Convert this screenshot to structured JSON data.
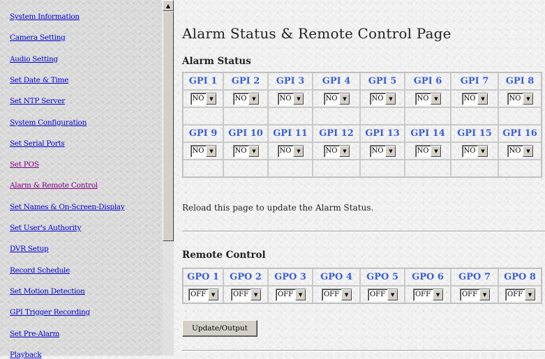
{
  "sidebar": {
    "items": [
      {
        "label": "System Information",
        "visited": false
      },
      {
        "label": "Camera Setting",
        "visited": false
      },
      {
        "label": "Audio Setting",
        "visited": false
      },
      {
        "label": "Set Date & Time",
        "visited": false
      },
      {
        "label": "Set NTP Server",
        "visited": false
      },
      {
        "label": "System Configuration",
        "visited": false
      },
      {
        "label": "Set Serial Ports",
        "visited": false
      },
      {
        "label": "Set POS",
        "visited": true
      },
      {
        "label": "Alarm & Remote Control",
        "visited": true
      },
      {
        "label": "Set Names & On-Screen-Display",
        "visited": false
      },
      {
        "label": "Set User's Authority",
        "visited": false
      },
      {
        "label": "DVR Setup",
        "visited": false
      },
      {
        "label": "Record Schedule",
        "visited": false
      },
      {
        "label": "Set Motion Detection",
        "visited": false
      },
      {
        "label": "GPI Trigger Recording",
        "visited": false
      },
      {
        "label": "Set Pre-Alarm",
        "visited": false
      },
      {
        "label": "Playback",
        "visited": false
      }
    ]
  },
  "page": {
    "title": "Alarm Status & Remote Control Page"
  },
  "alarm_status": {
    "heading": "Alarm Status",
    "rows": [
      {
        "headers": [
          "GPI 1",
          "GPI 2",
          "GPI 3",
          "GPI 4",
          "GPI 5",
          "GPI 6",
          "GPI 7",
          "GPI 8"
        ],
        "values": [
          "NO",
          "NO",
          "NO",
          "NO",
          "NO",
          "NO",
          "NO",
          "NO"
        ]
      },
      {
        "headers": [
          "GPI 9",
          "GPI 10",
          "GPI 11",
          "GPI 12",
          "GPI 13",
          "GPI 14",
          "GPI 15",
          "GPI 16"
        ],
        "values": [
          "NO",
          "NO",
          "NO",
          "NO",
          "NO",
          "NO",
          "NO",
          "NO"
        ]
      }
    ],
    "note": "Reload this page to update the Alarm Status."
  },
  "remote_control": {
    "heading": "Remote Control",
    "headers": [
      "GPO 1",
      "GPO 2",
      "GPO 3",
      "GPO 4",
      "GPO 5",
      "GPO 6",
      "GPO 7",
      "GPO 8"
    ],
    "values": [
      "OFF",
      "OFF",
      "OFF",
      "OFF",
      "OFF",
      "OFF",
      "OFF",
      "OFF"
    ],
    "button_label": "Update/Output"
  },
  "colors": {
    "link": "#0000cc",
    "visited_link": "#800080",
    "gpi_header": "#3a5fd6"
  }
}
